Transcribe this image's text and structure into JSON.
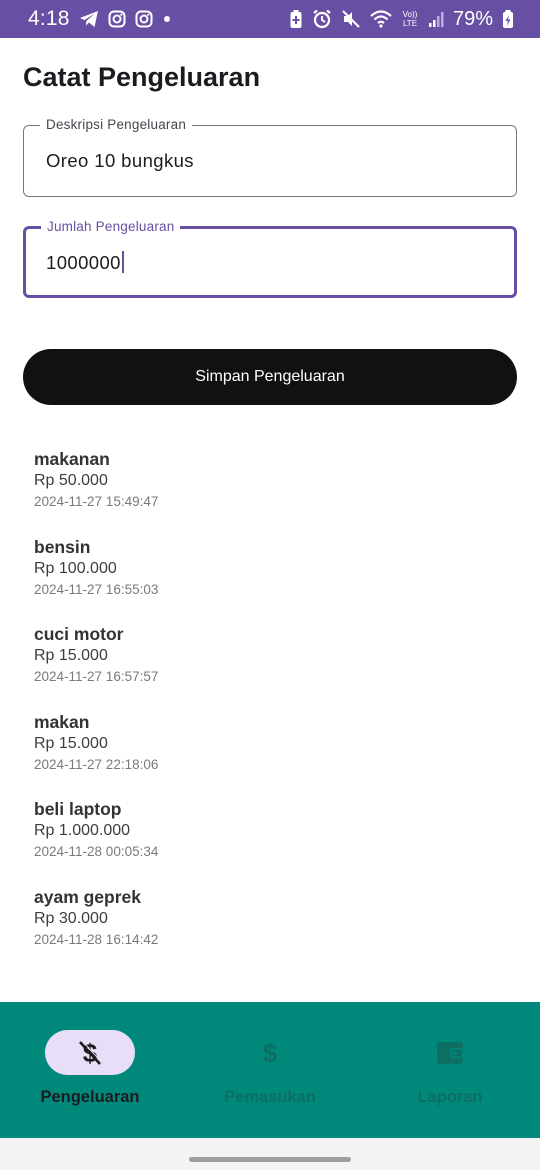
{
  "status_bar": {
    "time": "4:18",
    "battery_percent": "79%",
    "left_icons": [
      "telegram-icon",
      "instagram-icon",
      "instagram-icon",
      "dot-icon"
    ],
    "right_icons": [
      "battery-saver-icon",
      "alarm-icon",
      "mute-icon",
      "wifi-icon",
      "volte-icon",
      "signal-icon",
      "battery-charging-icon"
    ],
    "volte_text": "Vo)) LTE",
    "background_color": "#6750a4"
  },
  "page": {
    "title": "Catat Pengeluaran"
  },
  "form": {
    "description_field": {
      "label": "Deskripsi Pengeluaran",
      "value": "Oreo 10 bungkus"
    },
    "amount_field": {
      "label": "Jumlah Pengeluaran",
      "value": "1000000",
      "focused": true
    },
    "save_button_label": "Simpan Pengeluaran"
  },
  "expenses": [
    {
      "description": "makanan",
      "amount": "Rp 50.000",
      "timestamp": "2024-11-27 15:49:47"
    },
    {
      "description": "bensin",
      "amount": "Rp 100.000",
      "timestamp": "2024-11-27 16:55:03"
    },
    {
      "description": "cuci motor",
      "amount": "Rp 15.000",
      "timestamp": "2024-11-27 16:57:57"
    },
    {
      "description": "makan",
      "amount": "Rp 15.000",
      "timestamp": "2024-11-27 22:18:06"
    },
    {
      "description": "beli laptop",
      "amount": "Rp 1.000.000",
      "timestamp": "2024-11-28 00:05:34"
    },
    {
      "description": "ayam geprek",
      "amount": "Rp 30.000",
      "timestamp": "2024-11-28 16:14:42"
    }
  ],
  "bottom_nav": {
    "items": [
      {
        "label": "Pengeluaran",
        "icon": "money-off-icon",
        "active": true
      },
      {
        "label": "Pemasukan",
        "icon": "dollar-icon",
        "active": false
      },
      {
        "label": "Laporan",
        "icon": "wallet-icon",
        "active": false
      }
    ],
    "background_color": "#00897b",
    "active_indicator_color": "#e8def8"
  }
}
